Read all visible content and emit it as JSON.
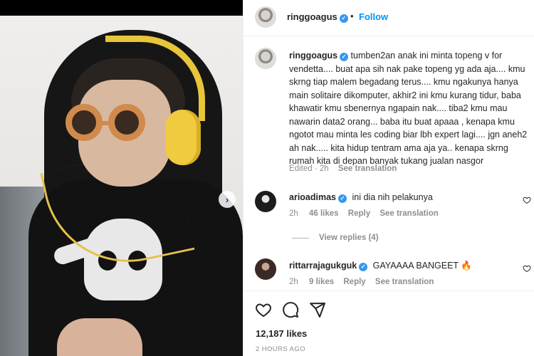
{
  "post": {
    "author": "ringgoagus",
    "follow_label": "Follow",
    "dot": "•",
    "caption": "tumben2an anak ini minta topeng v for vendetta.... buat apa sih nak pake topeng yg ada aja.... kmu skrng tiap malem begadang terus.... kmu ngakunya hanya main solitaire dikomputer, akhir2 ini kmu kurang tidur, baba khawatir kmu sbenernya ngapain nak.... tiba2 kmu mau nawarin data2 orang... baba itu buat apaaa , kenapa kmu ngotot mau minta les coding biar lbh expert lagi.... jgn aneh2 ah nak..... kita hidup tentram ama aja ya.. kenapa skrng rumah kita di depan banyak tukang jualan nasgor",
    "caption_lines": [
      "tumben2an anak ini minta topeng v for vendetta....",
      "buat apa sih nak pake topeng yg ada aja.... kmu skrng tiap malem",
      "begadang terus.... kmu ngakunya hanya main solitaire",
      "dikomputer, akhir2 ini kmu kurang tidur, baba khawatir kmu",
      "sbenernya ngapain nak.... tiba2 kmu mau nawarin data2 orang...",
      "baba itu buat apaaa , kenapa kmu ngotot mau minta les coding biar",
      "lbh expert lagi.... jgn aneh2 ah nak..... kita hidup tentram ama aja",
      "ya.. kenapa skrng rumah kita di depan banyak tukang jualan",
      "nasgor"
    ],
    "edited_label": "Edited",
    "caption_age": "2h",
    "see_translation": "See translation",
    "likes": "12,187 likes",
    "timestamp": "2 HOURS AGO"
  },
  "comments": [
    {
      "username": "arioadimas",
      "text": "ini dia nih pelakunya",
      "age": "2h",
      "likes": "46 likes",
      "reply_label": "Reply",
      "see_translation": "See translation",
      "view_replies": "View replies (4)"
    },
    {
      "username": "rittarrajagukguk",
      "text": "GAYAAAA BANGEET 🔥",
      "age": "2h",
      "likes": "9 likes",
      "reply_label": "Reply",
      "see_translation": "See translation"
    }
  ],
  "icons": {
    "verified": "verified-badge-icon",
    "next": "chevron-right-icon",
    "like": "heart-icon",
    "comment": "comment-icon",
    "share": "send-icon"
  },
  "colors": {
    "link": "#0095f6",
    "verified": "#3897f0",
    "muted": "#8e8e8e",
    "text": "#262626"
  }
}
